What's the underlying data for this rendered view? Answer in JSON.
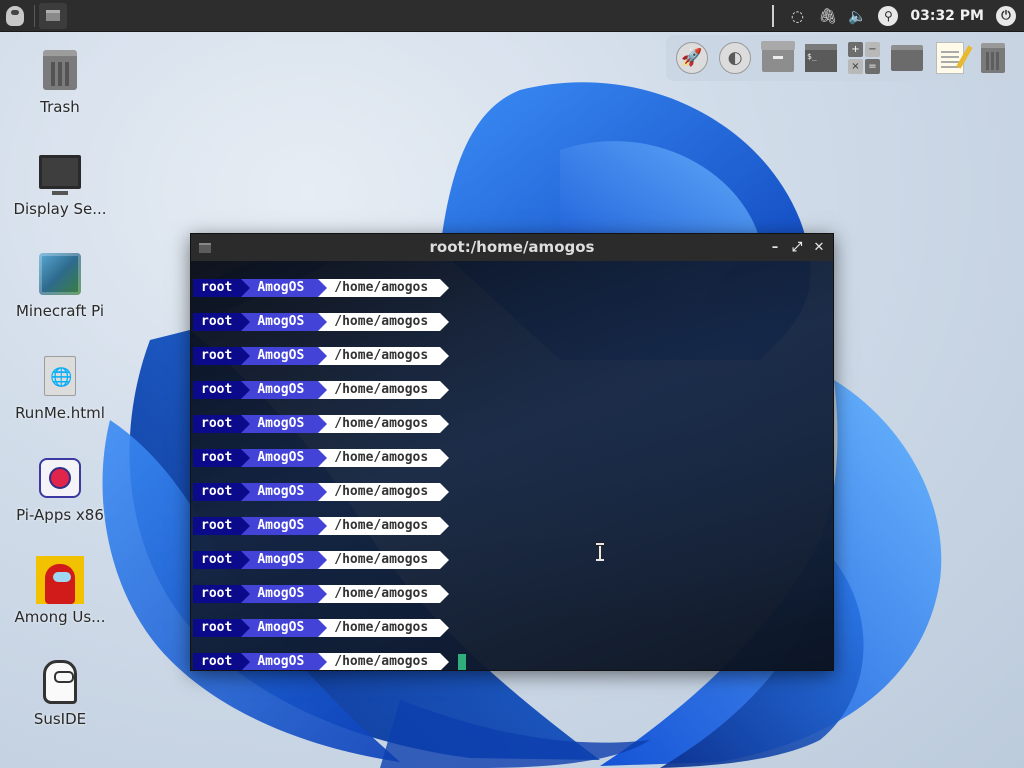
{
  "top_panel": {
    "menu_icon": "amogos-logo-icon",
    "taskbar": [
      {
        "name": "terminal-task",
        "icon": "terminal-icon"
      }
    ],
    "tray_icons": [
      "refresh-icon",
      "paperclip-icon",
      "volume-icon"
    ],
    "search_icon": "search-icon",
    "clock": "03:32 PM",
    "power_icon": "power-icon"
  },
  "dock": {
    "items": [
      {
        "name": "launcher",
        "icon": "rocket-icon"
      },
      {
        "name": "browser",
        "icon": "firefox-icon"
      },
      {
        "name": "archive-manager",
        "icon": "archive-icon"
      },
      {
        "name": "terminal",
        "icon": "terminal-icon"
      },
      {
        "name": "calculator",
        "icon": "calculator-icon"
      },
      {
        "name": "file-manager",
        "icon": "folder-icon"
      },
      {
        "name": "text-editor",
        "icon": "notepad-icon"
      },
      {
        "name": "trash",
        "icon": "trash-icon"
      }
    ]
  },
  "desktop": {
    "icons": [
      {
        "label": "Trash",
        "icon": "trash-icon"
      },
      {
        "label": "Display Se...",
        "icon": "monitor-icon"
      },
      {
        "label": "Minecraft Pi",
        "icon": "minecraft-block-icon"
      },
      {
        "label": "RunMe.html",
        "icon": "html-file-icon"
      },
      {
        "label": "Pi-Apps x86",
        "icon": "pi-apps-icon"
      },
      {
        "label": "Among Us...",
        "icon": "among-us-icon"
      },
      {
        "label": "SusIDE",
        "icon": "sus-ide-icon"
      }
    ]
  },
  "terminal": {
    "title": "root:/home/amogos",
    "controls": {
      "minimize": "–",
      "maximize": "⤢",
      "close": "✕"
    },
    "prompt": {
      "user": "root",
      "host": "AmogOS",
      "path": "/home/amogos"
    },
    "prompt_count": 12,
    "colors": {
      "user_bg": "#0a0a8a",
      "host_bg": "#4343d8",
      "path_bg": "#ffffff",
      "cursor": "#2fae7c"
    }
  }
}
